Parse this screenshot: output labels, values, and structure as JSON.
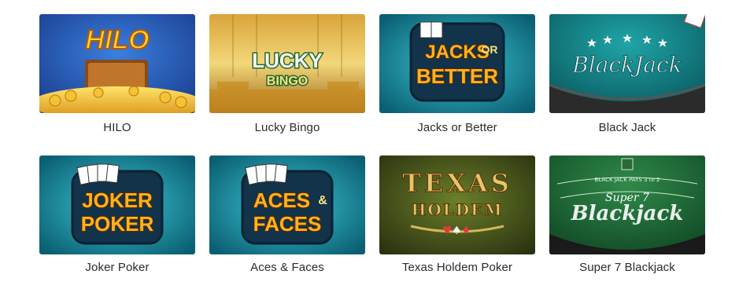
{
  "games": [
    {
      "title": "HILO",
      "art_text": [
        "HILO"
      ]
    },
    {
      "title": "Lucky Bingo",
      "art_text": [
        "LUCKY",
        "BINGO"
      ]
    },
    {
      "title": "Jacks or Better",
      "art_text": [
        "JACKS",
        "OR",
        "BETTER"
      ]
    },
    {
      "title": "Black Jack",
      "art_text": [
        "BlackJack"
      ]
    },
    {
      "title": "Joker Poker",
      "art_text": [
        "JOKER",
        "POKER"
      ]
    },
    {
      "title": "Aces & Faces",
      "art_text": [
        "ACES",
        "&",
        "FACES"
      ]
    },
    {
      "title": "Texas Holdem Poker",
      "art_text": [
        "TEXAS",
        "HOLDEM"
      ]
    },
    {
      "title": "Super 7 Blackjack",
      "art_text": [
        "BLACK JACK PAYS 3 to 2",
        "Super 7",
        "Blackjack"
      ]
    }
  ]
}
